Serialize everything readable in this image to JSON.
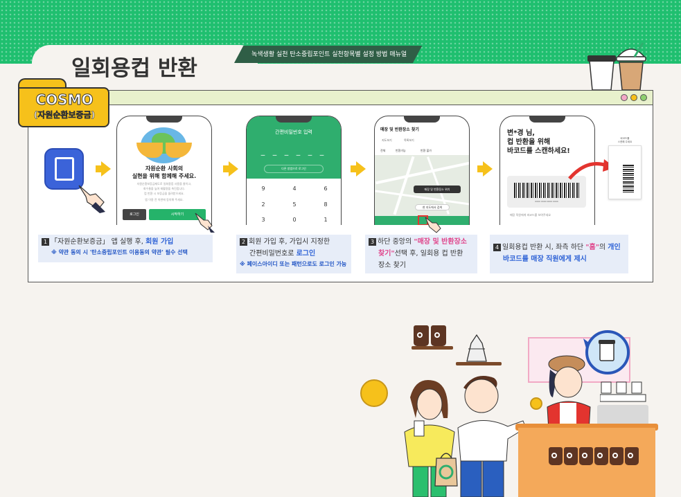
{
  "header": {
    "title": "일회용컵 반환",
    "subtitle": "녹색생활 실천 탄소중립포인트 실천항목별 설정 방법 매뉴얼"
  },
  "brand": {
    "name": "COSMO",
    "sub": "(자원순환보증금)"
  },
  "colors": {
    "band": "#1fbf6f",
    "accent_yellow": "#f6c11b",
    "highlight_blue": "#2f63d6",
    "highlight_pink": "#e0458b",
    "caption_bg": "#e7edf8"
  },
  "window_dots": [
    "#f3a8c6",
    "#f6c11b",
    "#8fd06e"
  ],
  "phone1": {
    "heading_line1": "자원순환 사회의",
    "heading_line2": "실현을 위해 함께해 주세요.",
    "body_line1": "자원순환보증금제도로 일회용컵 사용을 줄이고,",
    "body_line2": "회수율을 높여 재활용을 촉진합니다.",
    "body_line3": "컵 반환 시 보증금을 돌려받으세요.",
    "footer": "앱 이용 전 약관에 동의해 주세요.",
    "login_label": "로그인",
    "start_label": "시작하기"
  },
  "phone2": {
    "title": "간편비밀번호 입력",
    "dashes": "_ _ _ _ _ _",
    "dropdown": "다른 방법으로 로그인",
    "keys": [
      "9",
      "4",
      "6",
      "2",
      "5",
      "8",
      "3",
      "0",
      "1"
    ]
  },
  "phone3": {
    "title": "매장 및 반환장소 찾기",
    "tabs": [
      "지도보기",
      "목록보기"
    ],
    "legend": [
      "전체",
      "반환가능",
      "반환 불가"
    ],
    "popup": "매장 및 반환장소 위치",
    "popup2": "현 지도에서 검색"
  },
  "phone4": {
    "heading_line1": "변*경 님,",
    "heading_line2": "컵 반환을 위해",
    "heading_line3": "바코드를 스캔하세요!",
    "code": "0000 0000 0000 0000",
    "footer": "매장 직원에게 바코드를 보여주세요"
  },
  "scanner": {
    "label_line1": "바코드를",
    "label_line2": "스캔해 주세요"
  },
  "captions": {
    "c1": {
      "num": "1",
      "pre": "「자원순환보증금」 앱 실행 후, ",
      "hl": "회원 가입",
      "note": "※ 약관 동의 시 '탄소중립포인트 이용동의 약관' 필수 선택"
    },
    "c2": {
      "num": "2",
      "line1": "회원 가입 후, 가입시 지정한",
      "line2_pre": "간편비밀번호로 ",
      "line2_hl": "로그인",
      "note": "※ 페이스아이디 또는 패턴으로도 로그인 가능"
    },
    "c3": {
      "num": "3",
      "pre": "하단 중앙의 ",
      "hl": "\"매장 및 반환장소",
      "hl2": "찾기\"",
      "post": "선택 후, 일회용 컵 반환",
      "line3": "장소 찾기"
    },
    "c4": {
      "num": "4",
      "pre": "일회용컵 반환 시, 좌측 하단 ",
      "hl_pink": "\"홈\"",
      "mid": "의 ",
      "hl": "개인",
      "line2_hl": "바코드를 매장 직원에게 제시"
    }
  },
  "icons": [
    "app-icon",
    "hand-pointer-icon",
    "globe-icon",
    "map-pin-icon",
    "coffee-cup-icon",
    "recycle-icon",
    "refresh-cup-icon"
  ]
}
